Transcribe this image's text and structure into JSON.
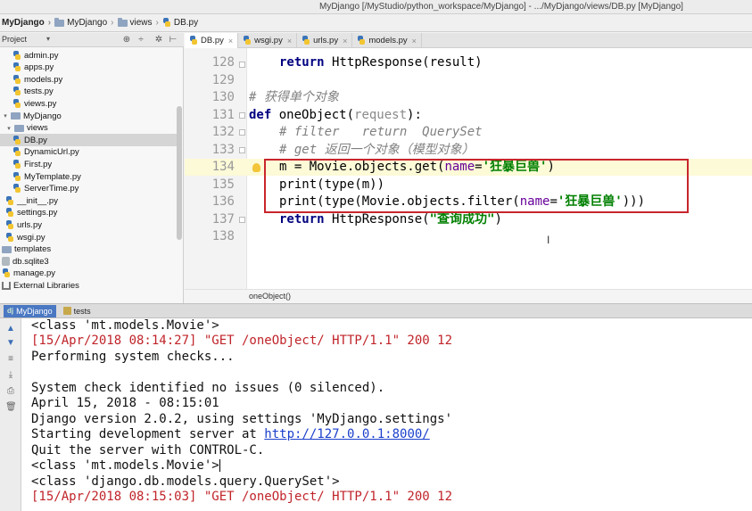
{
  "window": {
    "title": "MyDjango [/MyStudio/python_workspace/MyDjango] - .../MyDjango/views/DB.py [MyDjango]"
  },
  "nav": {
    "crumbs": [
      "MyDjango",
      "MyDjango",
      "views",
      "DB.py"
    ]
  },
  "project_panel": {
    "label": "Project",
    "tree": [
      {
        "label": "admin.py",
        "kind": "py",
        "depth": 2
      },
      {
        "label": "apps.py",
        "kind": "py",
        "depth": 2
      },
      {
        "label": "models.py",
        "kind": "py",
        "depth": 2
      },
      {
        "label": "tests.py",
        "kind": "py",
        "depth": 2
      },
      {
        "label": "views.py",
        "kind": "py",
        "depth": 2
      },
      {
        "label": "MyDjango",
        "kind": "dir",
        "depth": 0,
        "arrow": "▾"
      },
      {
        "label": "views",
        "kind": "dir",
        "depth": 1,
        "arrow": "▾"
      },
      {
        "label": "DB.py",
        "kind": "py",
        "depth": 2,
        "selected": true
      },
      {
        "label": "DynamicUrl.py",
        "kind": "py",
        "depth": 2
      },
      {
        "label": "First.py",
        "kind": "py",
        "depth": 2
      },
      {
        "label": "MyTemplate.py",
        "kind": "py",
        "depth": 2
      },
      {
        "label": "ServerTime.py",
        "kind": "py",
        "depth": 2
      },
      {
        "label": "__init__.py",
        "kind": "py",
        "depth": 1
      },
      {
        "label": "settings.py",
        "kind": "py",
        "depth": 1
      },
      {
        "label": "urls.py",
        "kind": "py",
        "depth": 1
      },
      {
        "label": "wsgi.py",
        "kind": "py",
        "depth": 1
      },
      {
        "label": "templates",
        "kind": "dir",
        "depth": 0
      },
      {
        "label": "db.sqlite3",
        "kind": "db",
        "depth": 0
      },
      {
        "label": "manage.py",
        "kind": "py",
        "depth": 0
      },
      {
        "label": "External Libraries",
        "kind": "lib",
        "depth": 0
      }
    ]
  },
  "editor": {
    "tabs": [
      {
        "label": "DB.py",
        "active": true
      },
      {
        "label": "wsgi.py",
        "active": false
      },
      {
        "label": "urls.py",
        "active": false
      },
      {
        "label": "models.py",
        "active": false
      }
    ],
    "line_numbers": [
      "128",
      "129",
      "130",
      "131",
      "132",
      "133",
      "134",
      "135",
      "136",
      "137",
      "138"
    ],
    "lines": {
      "l128_kw": "return",
      "l128_rest": " HttpResponse(result)",
      "l130": "# 获得单个对象",
      "l131_kw": "def",
      "l131_name": " oneObject(",
      "l131_param": "request",
      "l131_end": "):",
      "l132": "# filter   return  QuerySet",
      "l133": "# get 返回一个对象（模型对象）",
      "l134_a": "m = Movie.objects.get(",
      "l134_p": "name",
      "l134_eq": "=",
      "l134_s": "'狂暴巨兽'",
      "l134_e": ")",
      "l135": "print(type(m))",
      "l136_a": "print(type(Movie.objects.filter(",
      "l136_p": "name",
      "l136_eq": "=",
      "l136_s": "'狂暴巨兽'",
      "l136_e": ")))",
      "l137_kw": "return",
      "l137_a": " HttpResponse(",
      "l137_s": "\"查询成功\"",
      "l137_e": ")"
    },
    "breadcrumb": "oneObject()"
  },
  "run": {
    "tabs": [
      {
        "label": "MyDjango",
        "active": true
      },
      {
        "label": "tests",
        "active": false
      }
    ],
    "console": {
      "c1": "<class 'mt.models.Movie'>",
      "c2": "[15/Apr/2018 08:14:27] \"GET /oneObject/ HTTP/1.1\" 200 12",
      "c3": "Performing system checks...",
      "c5": "System check identified no issues (0 silenced).",
      "c6": "April 15, 2018 - 08:15:01",
      "c7": "Django version 2.0.2, using settings 'MyDjango.settings'",
      "c8_a": "Starting development server at ",
      "c8_link": "http://127.0.0.1:8000/",
      "c9": "Quit the server with CONTROL-C.",
      "c10": "<class 'mt.models.Movie'>",
      "c11": "<class 'django.db.models.query.QuerySet'>",
      "c12": "[15/Apr/2018 08:15:03] \"GET /oneObject/ HTTP/1.1\" 200 12"
    }
  }
}
